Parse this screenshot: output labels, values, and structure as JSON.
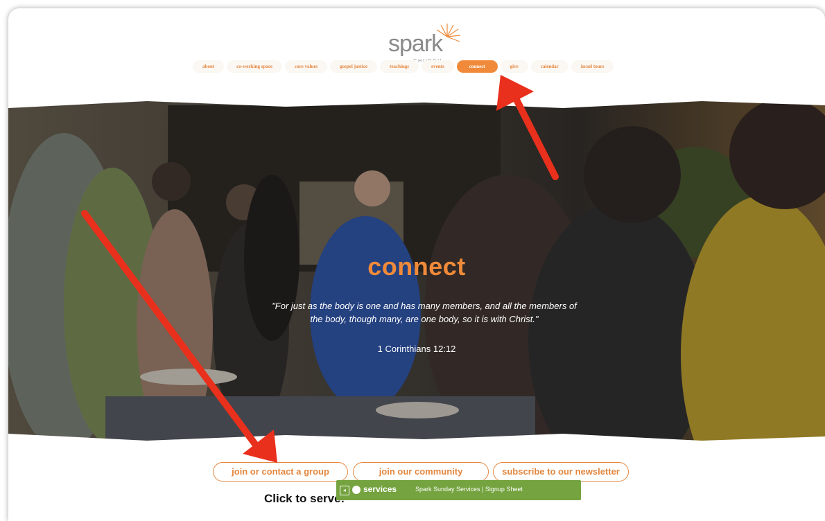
{
  "logo": {
    "word": "spark",
    "sub": "CHURCH"
  },
  "nav": {
    "items": [
      {
        "label": "about"
      },
      {
        "label": "co-working space"
      },
      {
        "label": "core values"
      },
      {
        "label": "gospel justice"
      },
      {
        "label": "teachings"
      },
      {
        "label": "events"
      },
      {
        "label": "connect",
        "active": true
      },
      {
        "label": "give"
      },
      {
        "label": "calendar"
      },
      {
        "label": "israel tours"
      }
    ]
  },
  "hero": {
    "title": "connect",
    "quote": "\"For just as the body is one and has many members, and all the members of the body, though many, are one body, so it is with Christ.\"",
    "reference": "1 Corinthians 12:12"
  },
  "buttons": {
    "group": "join or contact a group",
    "community": "join our community",
    "newsletter": "subscribe to our newsletter"
  },
  "serve": {
    "label": "Click to serve:",
    "widget_logo": "services",
    "widget_title": "Spark Sunday Services | Signup Sheet"
  },
  "colors": {
    "accent": "#f08a3a",
    "annotation_arrow": "#e8301c",
    "widget_green": "#74a33f"
  }
}
